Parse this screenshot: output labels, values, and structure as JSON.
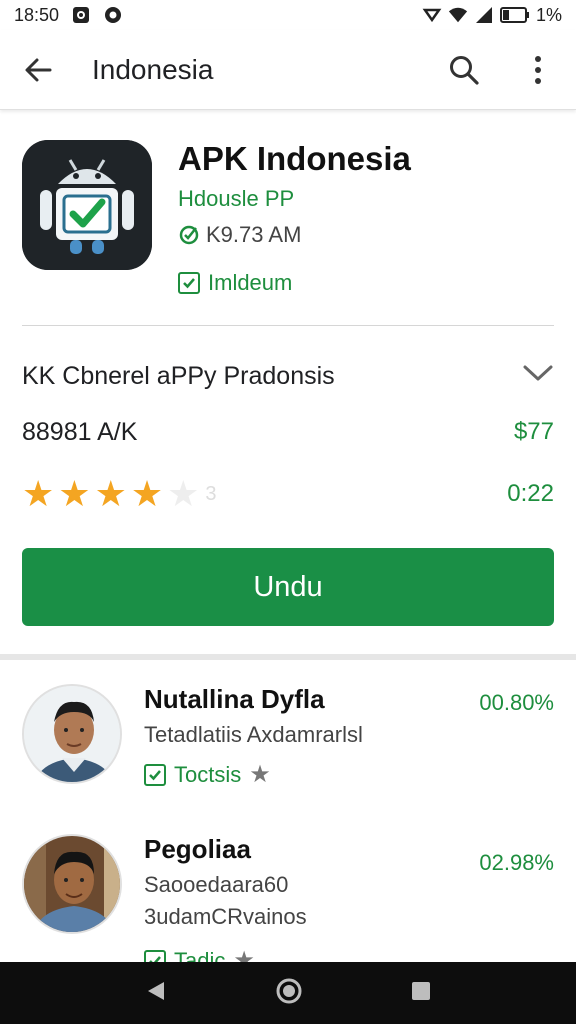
{
  "status_bar": {
    "time": "18:50",
    "battery": "1%",
    "icons": [
      "notification-icon",
      "circle-app-icon",
      "data-saver-icon",
      "wifi-icon",
      "signal-icon",
      "battery-icon"
    ]
  },
  "app_bar": {
    "title": "Indonesia",
    "icons": [
      "back-arrow-icon",
      "search-icon",
      "more-vert-icon"
    ]
  },
  "app": {
    "name": "APK Indonesia",
    "developer": "Hdousle PP",
    "time": "K9.73 AM",
    "badge": "Imldeum"
  },
  "details": {
    "category": "KK Cbnerel aPPy Pradonsis",
    "size": "88981 A/K",
    "price": "$77",
    "rating_value": 4,
    "rating_max": 5,
    "rating_trail": "3",
    "rating_time": "0:22"
  },
  "install_button": {
    "label": "Undu"
  },
  "reviews": [
    {
      "name": "Nutallina Dyfla",
      "subtitle": "Tetadlatiis Axdamrarlsl",
      "tag": "Toctsis",
      "percent": "00.80%"
    },
    {
      "name": "Pegoliaa",
      "subtitle": "Saooedaara60",
      "subtitle2": "3udamCRvainos",
      "tag": "Tadic",
      "percent": "02.98%"
    }
  ],
  "colors": {
    "accent": "#1a8f46",
    "green_text": "#1e8e3e",
    "star": "#f4a522",
    "nav_bar": "#0d0d0d"
  }
}
